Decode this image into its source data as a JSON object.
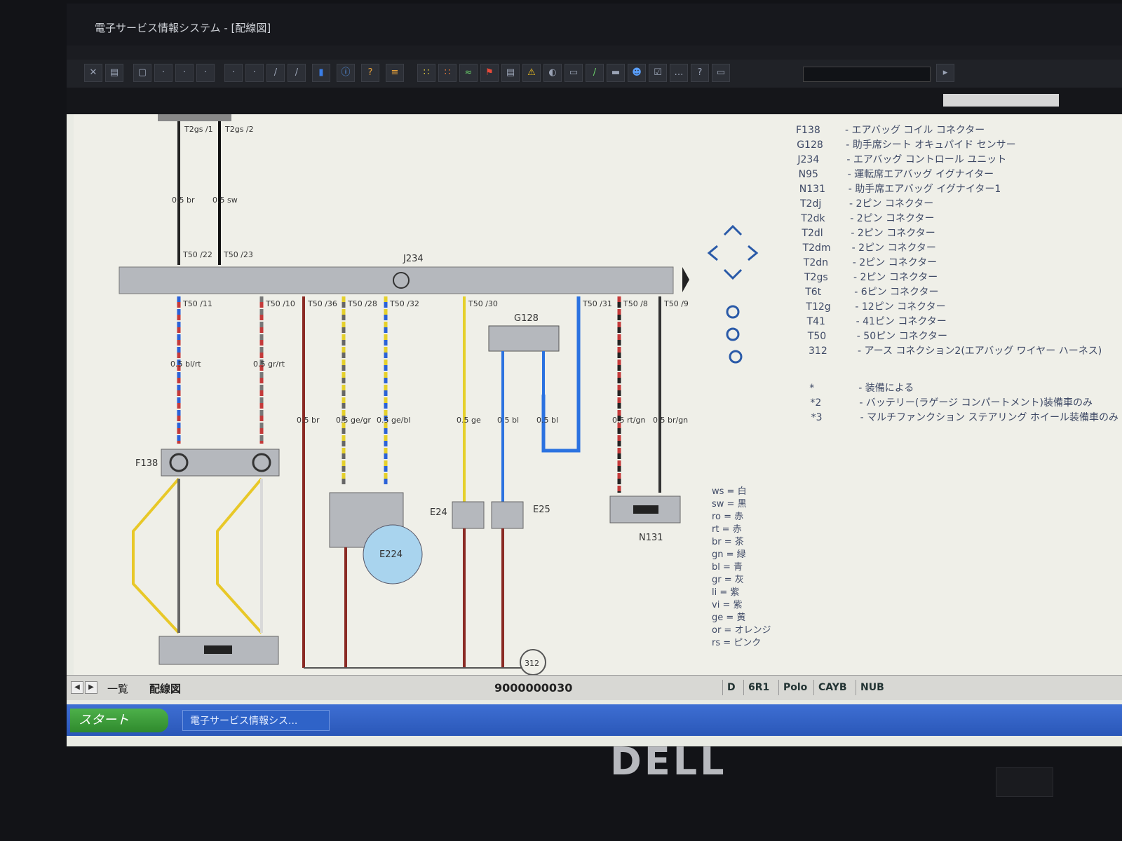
{
  "window": {
    "title": "電子サービス情報システム - [配線図]"
  },
  "component_label": "J234",
  "components": {
    "F138": "F138",
    "G128": "G128",
    "E24": "E24",
    "E25": "E25",
    "E224": "E224",
    "N131": "N131",
    "ground": "312"
  },
  "legend": {
    "components": [
      {
        "code": "F138",
        "desc": "エアバッグ コイル コネクター"
      },
      {
        "code": "G128",
        "desc": "助手席シート オキュパイド センサー"
      },
      {
        "code": "J234",
        "desc": "エアバッグ コントロール ユニット"
      },
      {
        "code": "N95",
        "desc": "運転席エアバッグ イグナイター"
      },
      {
        "code": "N131",
        "desc": "助手席エアバッグ イグナイター1"
      },
      {
        "code": "T2dj",
        "desc": "2ピン コネクター"
      },
      {
        "code": "T2dk",
        "desc": "2ピン コネクター"
      },
      {
        "code": "T2dl",
        "desc": "2ピン コネクター"
      },
      {
        "code": "T2dm",
        "desc": "2ピン コネクター"
      },
      {
        "code": "T2dn",
        "desc": "2ピン コネクター"
      },
      {
        "code": "T2gs",
        "desc": "2ピン コネクター"
      },
      {
        "code": "T6t",
        "desc": "6ピン コネクター"
      },
      {
        "code": "T12g",
        "desc": "12ピン コネクター"
      },
      {
        "code": "T41",
        "desc": "41ピン コネクター"
      },
      {
        "code": "T50",
        "desc": "50ピン コネクター"
      },
      {
        "code": "312",
        "desc": "アース コネクション2(エアバッグ ワイヤー ハーネス)"
      }
    ],
    "notes": [
      {
        "code": "*",
        "desc": "装備による"
      },
      {
        "code": "*2",
        "desc": "バッテリー(ラゲージ コンパートメント)装備車のみ"
      },
      {
        "code": "*3",
        "desc": "マルチファンクション ステアリング ホイール装備車のみ"
      }
    ],
    "colors": [
      {
        "code": "ws",
        "name": "白"
      },
      {
        "code": "sw",
        "name": "黒"
      },
      {
        "code": "ro",
        "name": "赤"
      },
      {
        "code": "rt",
        "name": "赤"
      },
      {
        "code": "br",
        "name": "茶"
      },
      {
        "code": "gn",
        "name": "緑"
      },
      {
        "code": "bl",
        "name": "青"
      },
      {
        "code": "gr",
        "name": "灰"
      },
      {
        "code": "li",
        "name": "紫"
      },
      {
        "code": "vi",
        "name": "紫"
      },
      {
        "code": "ge",
        "name": "黄"
      },
      {
        "code": "or",
        "name": "オレンジ"
      },
      {
        "code": "rs",
        "name": "ピンク"
      }
    ]
  },
  "tabs": {
    "list": "一覧",
    "wiring": "配線図"
  },
  "status": {
    "doc_id": "9000000030",
    "cells": [
      "D",
      "6R1",
      "Polo",
      "CAYB",
      "NUB"
    ]
  },
  "taskbar": {
    "start": "スタート",
    "task": "電子サービス情報シス..."
  },
  "brand": "DELL",
  "wires": {
    "t2gs1": "T2gs /1",
    "t2gs2": "T2gs /2",
    "t50_22": "T50 /22",
    "t50_23": "T50 /23",
    "top_br": "0.5 br",
    "top_sw": "0.5 sw",
    "t50_11": "T50 /11",
    "t50_10": "T50 /10",
    "t50_36": "T50 /36",
    "t50_28": "T50 /28",
    "t50_32": "T50 /32",
    "t50_30": "T50 /30",
    "t50_31": "T50 /31",
    "t50_8": "T50 /8",
    "t50_9": "T50 /9",
    "w_blrt": "0.5 bl/rt",
    "w_grrt": "0.5 gr/rt",
    "w_br": "0.5 br",
    "w_gegr": "0.5 ge/gr",
    "w_gebl": "0.5 ge/bl",
    "w_ge": "0.5 ge",
    "w_bl1": "0.5 bl",
    "w_bl2": "0.5 bl",
    "w_rtgn": "0.5 rt/gn",
    "w_brgn": "0.5 br/gn"
  }
}
